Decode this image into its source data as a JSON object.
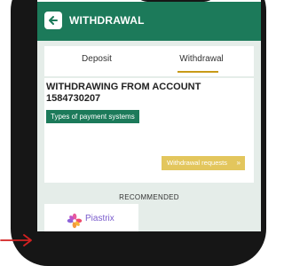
{
  "header": {
    "title": "WITHDRAWAL"
  },
  "tabs": [
    {
      "label": "Deposit"
    },
    {
      "label": "Withdrawal"
    }
  ],
  "card": {
    "title": "WITHDRAWING FROM ACCOUNT 1584730207",
    "payment_systems_label": "Types of payment systems",
    "withdrawal_requests_label": "Withdrawal requests"
  },
  "recommended": {
    "label": "RECOMMENDED",
    "items": [
      {
        "name": "Piastrix",
        "icon": "piastrix-flower-icon"
      }
    ]
  },
  "colors": {
    "primary": "#1c7a5a",
    "accent": "#e3c65d",
    "tab_underline": "#c79a17",
    "arrow": "#d22121",
    "piastrix": "#7a5ccc"
  }
}
